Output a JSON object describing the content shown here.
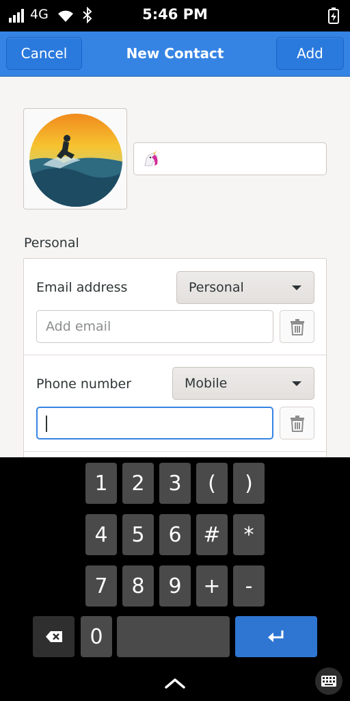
{
  "status_bar": {
    "network": "4G",
    "time": "5:46 PM",
    "icons": [
      "signal-icon",
      "wifi-icon",
      "bluetooth-icon",
      "battery-charging-icon"
    ]
  },
  "header": {
    "cancel_label": "Cancel",
    "title": "New Contact",
    "add_label": "Add",
    "accent_color": "#3584e4"
  },
  "name_field": {
    "value": "",
    "emoji_icon": "unicorn-icon"
  },
  "personal": {
    "section_label": "Personal",
    "email": {
      "label": "Email address",
      "type_selected": "Personal",
      "placeholder": "Add email",
      "value": ""
    },
    "phone": {
      "label": "Phone number",
      "type_selected": "Mobile",
      "value": ""
    }
  },
  "keyboard": {
    "rows": [
      [
        "1",
        "2",
        "3",
        "(",
        ")"
      ],
      [
        "4",
        "5",
        "6",
        "#",
        "*"
      ],
      [
        "7",
        "8",
        "9",
        "+",
        "-"
      ]
    ],
    "zero": "0",
    "enter_color": "#2f76d2"
  }
}
